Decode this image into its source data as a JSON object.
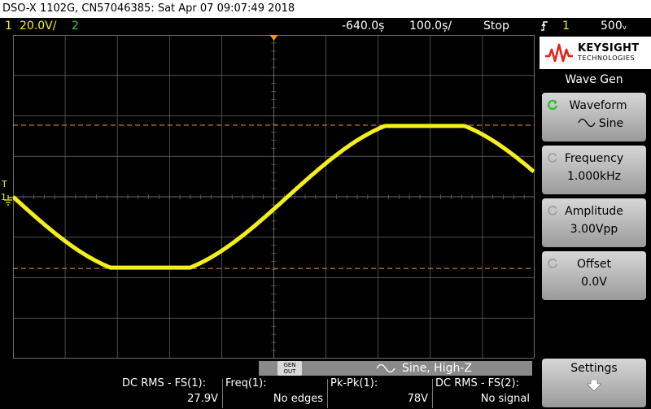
{
  "title_bar": {
    "text": "DSO-X 1102G, CN57046385: Sat Apr 07 09:07:49 2018"
  },
  "status_bar": {
    "ch1_num": "1",
    "ch1_scale": "20.0V/",
    "ch2_num": "2",
    "trigger_delay": "-640.0ș",
    "time_scale": "100.0ș/",
    "run_state": "Stop",
    "trigger_slope_icon": "rising-edge-icon",
    "trigger_source": "1",
    "trigger_level": "500ᵥ"
  },
  "colors": {
    "ch1": "#f4ef1c",
    "ch2": "#3ccb3a",
    "trigger_marker": "#f7941d",
    "grid": "#6a6a6a"
  },
  "waveform": {
    "type": "sine",
    "amplitude_divisions": 1.95,
    "clip_divisions": 1.75,
    "start_phase_deg": 180,
    "cycles_on_screen": 0.95
  },
  "markers": {
    "trigger_label": "T",
    "ground_label": "1"
  },
  "gen_bar": {
    "badge_line1": "GEN",
    "badge_line2": "OUT",
    "mode": "Sine, High-Z"
  },
  "measurements": [
    {
      "label": "DC RMS - FS(1):",
      "value": "27.9V"
    },
    {
      "label": "Freq(1):",
      "value": "No edges"
    },
    {
      "label": "Pk-Pk(1):",
      "value": "78V"
    },
    {
      "label": "DC RMS - FS(2):",
      "value": "No signal"
    }
  ],
  "side_panel": {
    "brand": "KEYSIGHT",
    "brand_sub": "TECHNOLOGIES",
    "menu_title": "Wave Gen",
    "softkeys": [
      {
        "label": "Waveform",
        "value": "Sine",
        "active": true
      },
      {
        "label": "Frequency",
        "value": "1.000kHz",
        "active": false
      },
      {
        "label": "Amplitude",
        "value": "3.00Vpp",
        "active": false
      },
      {
        "label": "Offset",
        "value": "0.0V",
        "active": false
      }
    ],
    "settings_label": "Settings"
  }
}
